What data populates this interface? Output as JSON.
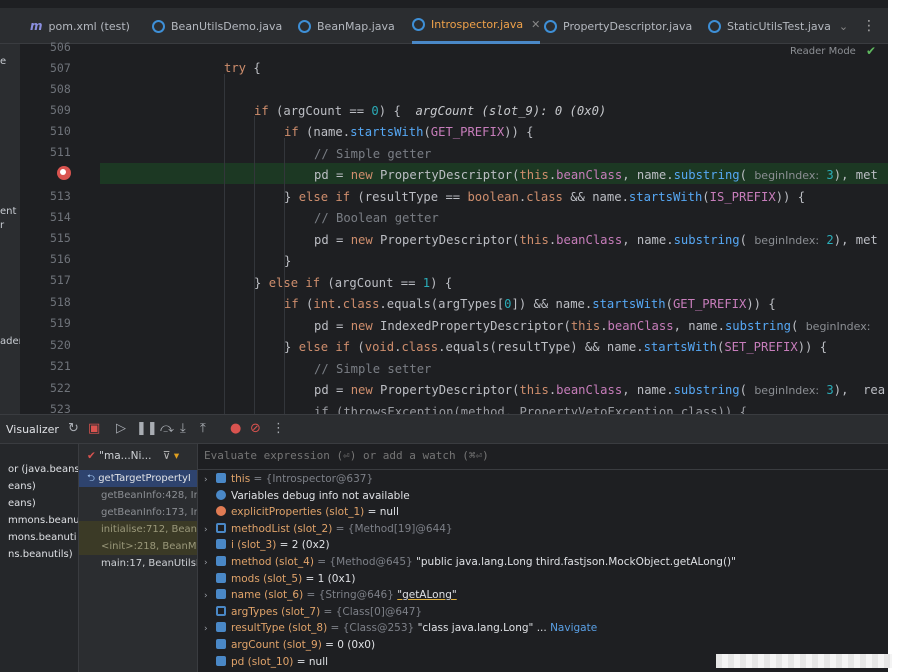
{
  "tabs": [
    {
      "label": "pom.xml (test)",
      "icon": "maven-icon"
    },
    {
      "label": "BeanUtilsDemo.java",
      "icon": "class-icon"
    },
    {
      "label": "BeanMap.java",
      "icon": "class-icon"
    },
    {
      "label": "Introspector.java",
      "icon": "class-icon",
      "active": true
    },
    {
      "label": "PropertyDescriptor.java",
      "icon": "class-icon"
    },
    {
      "label": "StaticUtilsTest.java",
      "icon": "class-icon"
    }
  ],
  "tab_overflow": "⌄",
  "tab_menu": "⋮",
  "reader_mode": "Reader Mode",
  "left_stripe": {
    "a": "e",
    "b": "ent",
    "c": "r",
    "d": "ader"
  },
  "line_numbers": [
    "506",
    "507",
    "508",
    "509",
    "510",
    "511",
    "",
    "513",
    "514",
    "515",
    "516",
    "517",
    "518",
    "519",
    "520",
    "521",
    "522",
    "523"
  ],
  "code": {
    "l507_kw": "try",
    "l507_rest": " {",
    "l509_kw": "if",
    "l509_rest": " (argCount == ",
    "l509_num": "0",
    "l509_close": ") {",
    "l509_inline": "argCount (slot_9): 0 (0x0)",
    "l510_kw": "if",
    "l510_a": " (name.",
    "l510_fn": "startsWith",
    "l510_b": "(",
    "l510_fld": "GET_PREFIX",
    "l510_c": ")) {",
    "l511_cmt": "// Simple getter",
    "l512_a": "pd = ",
    "l512_kw": "new",
    "l512_b": " PropertyDescriptor(",
    "l512_kw2": "this",
    "l512_c": ".",
    "l512_fld": "beanClass",
    "l512_d": ", name.",
    "l512_fn": "substring",
    "l512_e": "( ",
    "l512_hint": "beginIndex:",
    "l512_num": " 3",
    "l512_f": "), ",
    "l512_g": "met",
    "l513_a": "} ",
    "l513_kw": "else if",
    "l513_b": " (resultType == ",
    "l513_kw2": "boolean",
    "l513_c": ".",
    "l513_kw3": "class",
    "l513_d": " && name.",
    "l513_fn": "startsWith",
    "l513_e": "(",
    "l513_fld": "IS_PREFIX",
    "l513_f": ")) {",
    "l514_cmt": "// Boolean getter",
    "l515_a": "pd = ",
    "l515_kw": "new",
    "l515_b": " PropertyDescriptor(",
    "l515_kw2": "this",
    "l515_c": ".",
    "l515_fld": "beanClass",
    "l515_d": ", name.",
    "l515_fn": "substring",
    "l515_e": "( ",
    "l515_hint": "beginIndex:",
    "l515_num": " 2",
    "l515_f": "), met",
    "l516": "}",
    "l517_a": "} ",
    "l517_kw": "else if",
    "l517_b": " (argCount == ",
    "l517_num": "1",
    "l517_c": ") {",
    "l518_kw": "if",
    "l518_a": " (",
    "l518_kw2": "int",
    "l518_b": ".",
    "l518_kw3": "class",
    "l518_c": ".equals(argTypes[",
    "l518_num": "0",
    "l518_d": "]) && name.",
    "l518_fn": "startsWith",
    "l518_e": "(",
    "l518_fld": "GET_PREFIX",
    "l518_f": ")) {",
    "l519_a": "pd = ",
    "l519_kw": "new",
    "l519_b": " IndexedPropertyDescriptor(",
    "l519_kw2": "this",
    "l519_c": ".",
    "l519_fld": "beanClass",
    "l519_d": ", name.",
    "l519_fn": "substring",
    "l519_e": "( ",
    "l519_hint": "beginIndex:",
    "l520_a": "} ",
    "l520_kw": "else if",
    "l520_b": " (",
    "l520_kw2": "void",
    "l520_c": ".",
    "l520_kw3": "class",
    "l520_d": ".equals(resultType) && name.",
    "l520_fn": "startsWith",
    "l520_e": "(",
    "l520_fld": "SET_PREFIX",
    "l520_f": ")) {",
    "l521_cmt": "// Simple setter",
    "l522_a": "pd = ",
    "l522_kw": "new",
    "l522_b": " PropertyDescriptor(",
    "l522_kw2": "this",
    "l522_c": ".",
    "l522_fld": "beanClass",
    "l522_d": ", name.",
    "l522_fn": "substring",
    "l522_e": "( ",
    "l522_hint": "beginIndex:",
    "l522_num": " 3",
    "l522_f": "),  rea",
    "l523": "if (throwsException(method, PropertyVetoException.class)) {"
  },
  "debugger": {
    "title": "Visualizer",
    "frames_header": "\"ma...Ni...",
    "eval_placeholder": "Evaluate expression (⏎) or add a watch (⌘⏎)"
  },
  "threads": [
    "or (java.beans",
    "eans)",
    "eans)",
    "mmons.beanu",
    "mons.beanuti",
    "ns.beanutils)"
  ],
  "frames": [
    {
      "label": "getTargetPropertyI",
      "kind": "sel"
    },
    {
      "label": "getBeanInfo:428, In",
      "kind": "normal"
    },
    {
      "label": "getBeanInfo:173, In",
      "kind": "normal"
    },
    {
      "label": "initialise:712, BeanM",
      "kind": "lib"
    },
    {
      "label": "<init>:218, BeanMap",
      "kind": "lib"
    },
    {
      "label": "main:17, BeanUtilsDe",
      "kind": "normal"
    }
  ],
  "variables": [
    {
      "expand": "›",
      "icon": "p",
      "name": "this",
      "type": " = {Introspector@637}",
      "value": ""
    },
    {
      "expand": "",
      "icon": "info",
      "name": "",
      "type": "",
      "value": "Variables debug info not available"
    },
    {
      "expand": "",
      "icon": "f",
      "name": "explicitProperties (slot_1)",
      "type": "",
      "value": " = null"
    },
    {
      "expand": "›",
      "icon": "l",
      "name": "methodList (slot_2)",
      "type": " = {Method[19]@644}",
      "value": ""
    },
    {
      "expand": "",
      "icon": "p",
      "name": "i (slot_3)",
      "type": "",
      "value": " = 2 (0x2)"
    },
    {
      "expand": "›",
      "icon": "p",
      "name": "method (slot_4)",
      "type": " = {Method@645} ",
      "value": "\"public java.lang.Long third.fastjson.MockObject.getALong()\""
    },
    {
      "expand": "",
      "icon": "p",
      "name": "mods (slot_5)",
      "type": "",
      "value": " = 1 (0x1)"
    },
    {
      "expand": "›",
      "icon": "p",
      "name": "name (slot_6)",
      "type": " = {String@646} ",
      "value": "\"getALong\""
    },
    {
      "expand": "",
      "icon": "l",
      "name": "argTypes (slot_7)",
      "type": " = {Class[0]@647}",
      "value": ""
    },
    {
      "expand": "›",
      "icon": "p",
      "name": "resultType (slot_8)",
      "type": " = {Class@253} ",
      "value": "\"class java.lang.Long\" ... ",
      "link": "Navigate"
    },
    {
      "expand": "",
      "icon": "p",
      "name": "argCount (slot_9)",
      "type": "",
      "value": " = 0 (0x0)"
    },
    {
      "expand": "",
      "icon": "p",
      "name": "pd (slot_10)",
      "type": "",
      "value": " = null"
    }
  ]
}
